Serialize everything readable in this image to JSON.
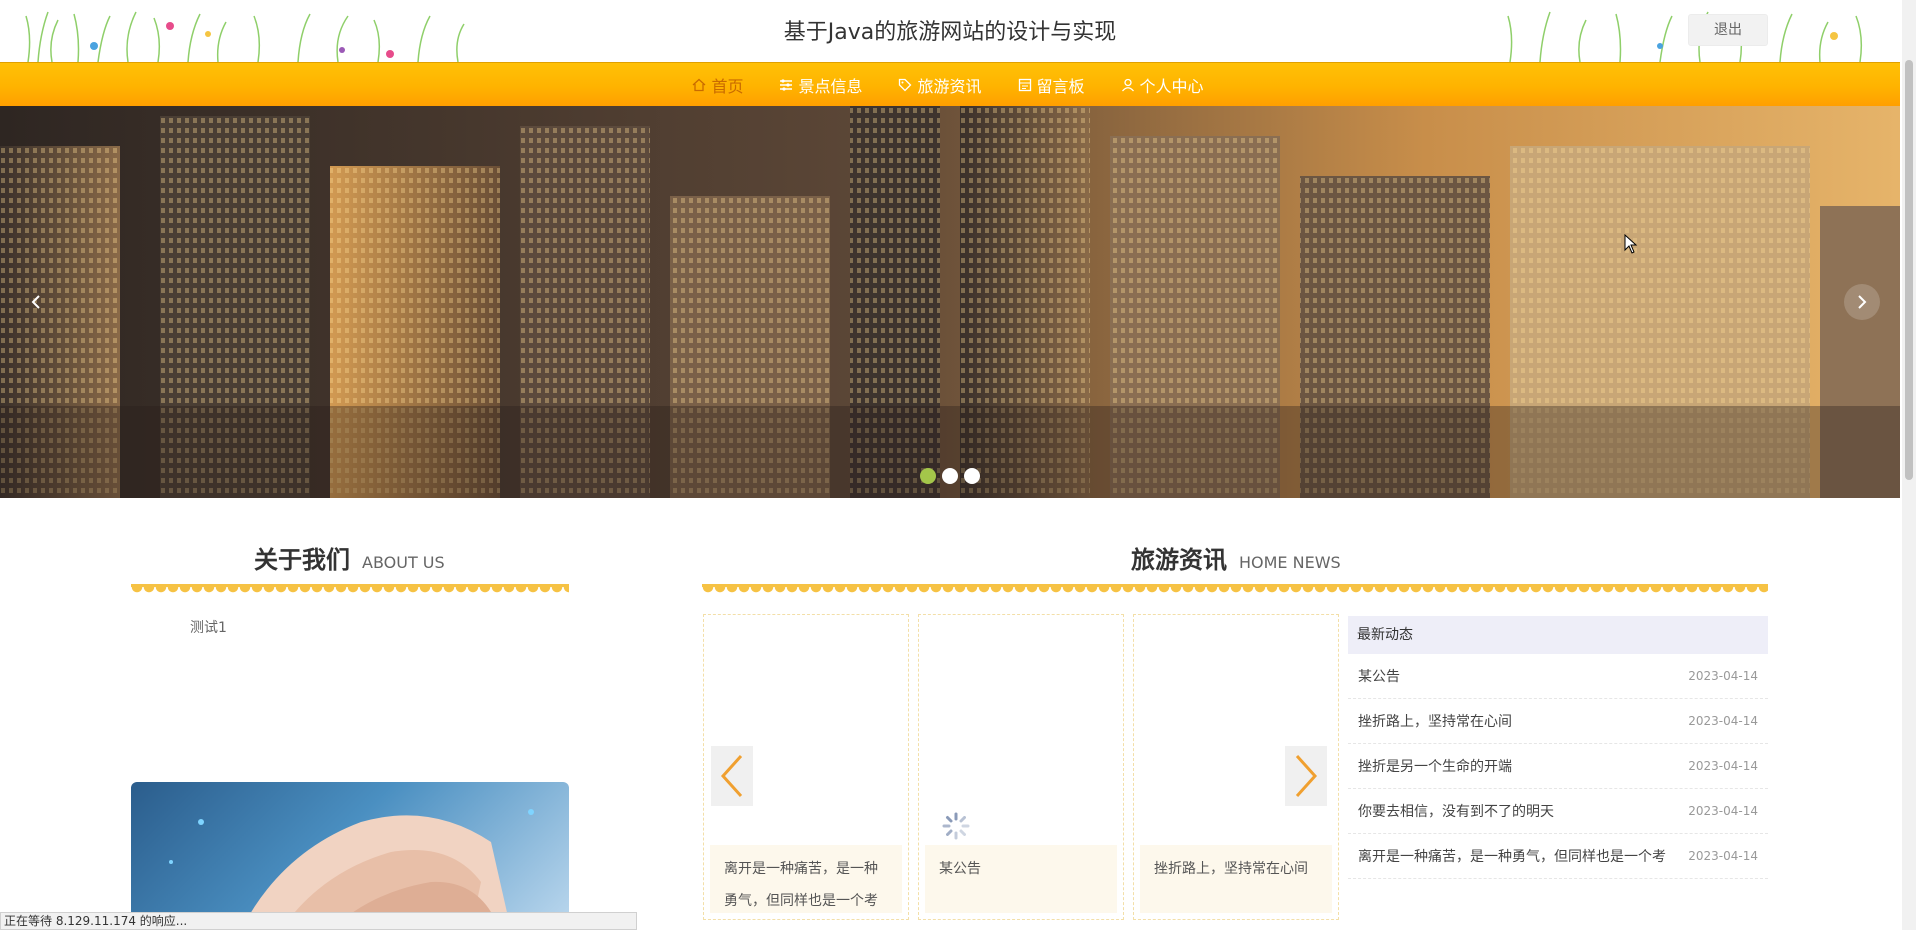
{
  "header": {
    "site_title": "基于Java的旅游网站的设计与实现",
    "logout_label": "退出"
  },
  "nav": {
    "items": [
      {
        "label": "首页",
        "icon": "home-icon",
        "active": true
      },
      {
        "label": "景点信息",
        "icon": "sliders-icon",
        "active": false
      },
      {
        "label": "旅游资讯",
        "icon": "tag-icon",
        "active": false
      },
      {
        "label": "留言板",
        "icon": "board-icon",
        "active": false
      },
      {
        "label": "个人中心",
        "icon": "user-icon",
        "active": false
      }
    ]
  },
  "banner": {
    "slide_count": 3,
    "active_slide": 1,
    "prev_icon": "chevron-left-icon",
    "next_icon": "chevron-right-icon"
  },
  "about": {
    "title_zh": "关于我们",
    "title_en": "ABOUT US",
    "text": "测试1"
  },
  "news": {
    "title_zh": "旅游资讯",
    "title_en": "HOME NEWS",
    "cards": [
      {
        "caption": "离开是一种痛苦，是一种勇气，但同样也是一个考"
      },
      {
        "caption": "某公告"
      },
      {
        "caption": "挫折路上，坚持常在心间"
      }
    ],
    "latest": {
      "heading": "最新动态",
      "items": [
        {
          "title": "某公告",
          "date": "2023-04-14"
        },
        {
          "title": "挫折路上，坚持常在心间",
          "date": "2023-04-14"
        },
        {
          "title": "挫折是另一个生命的开端",
          "date": "2023-04-14"
        },
        {
          "title": "你要去相信，没有到不了的明天",
          "date": "2023-04-14"
        },
        {
          "title": "离开是一种痛苦，是一种勇气，但同样也是一个考",
          "date": "2023-04-14"
        }
      ]
    }
  },
  "status": {
    "text": "正在等待 8.129.11.174 的响应..."
  },
  "colors": {
    "nav_top": "#ffc107",
    "nav_bottom": "#ff9f00",
    "accent": "#f6c244",
    "active_dot": "#a4c64a"
  }
}
